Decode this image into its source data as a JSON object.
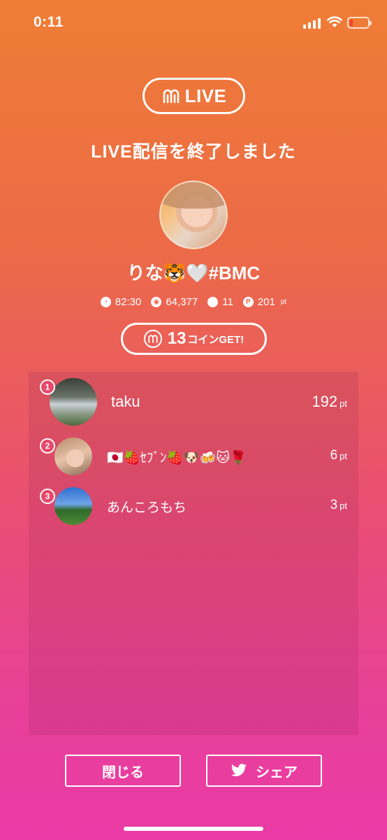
{
  "status_bar": {
    "time": "0:11"
  },
  "brand": {
    "logo_text": "LIVE"
  },
  "title": "LIVE配信を終了しました",
  "broadcaster": {
    "name": "りな🐯🤍#BMC"
  },
  "stats": {
    "duration": "82:30",
    "views": "64,377",
    "comments": "11",
    "points": "201",
    "points_unit": "pt"
  },
  "coins": {
    "count": "13",
    "label": "コインGET!"
  },
  "ranking": [
    {
      "rank": "1",
      "name": "taku",
      "points": "192",
      "unit": "pt"
    },
    {
      "rank": "2",
      "name": "🇯🇵🍓ｾﾌﾞﾝ🍓🐶🍻🐱🌹",
      "points": "6",
      "unit": "pt"
    },
    {
      "rank": "3",
      "name": "あんころもち",
      "points": "3",
      "unit": "pt"
    }
  ],
  "buttons": {
    "close": "閉じる",
    "share": "シェア"
  },
  "icons": [
    "m-logo-icon",
    "clock-icon",
    "eye-icon",
    "comment-icon",
    "point-icon",
    "twitter-icon"
  ]
}
